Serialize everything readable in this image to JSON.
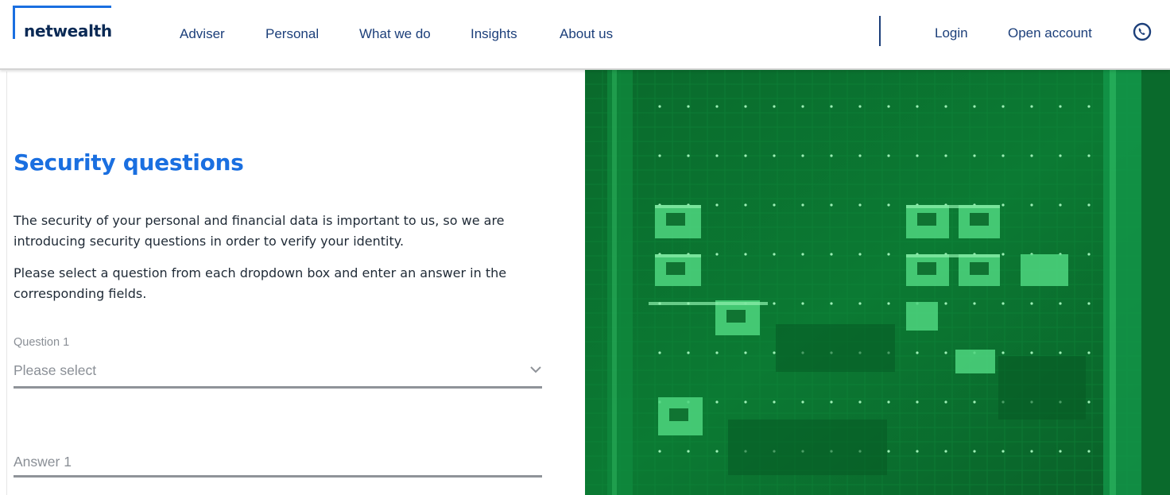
{
  "header": {
    "logo_text": "netwealth",
    "nav": [
      "Adviser",
      "Personal",
      "What we do",
      "Insights",
      "About us"
    ],
    "login_label": "Login",
    "open_account_label": "Open account"
  },
  "main": {
    "title": "Security questions",
    "intro_1": "The security of your personal and financial data is important to us, so we are introducing security questions in order to verify your identity.",
    "intro_2": "Please select a question from each dropdown box and enter an answer in the corresponding fields.",
    "question1_label": "Question 1",
    "question1_value": "Please select",
    "answer1_placeholder": "Answer 1"
  },
  "colors": {
    "brand_blue": "#1a6fe0",
    "nav_navy": "#1c3f7a",
    "hero_green": "#0e7a35"
  },
  "icons": [
    "phone-icon",
    "chevron-down-icon"
  ]
}
